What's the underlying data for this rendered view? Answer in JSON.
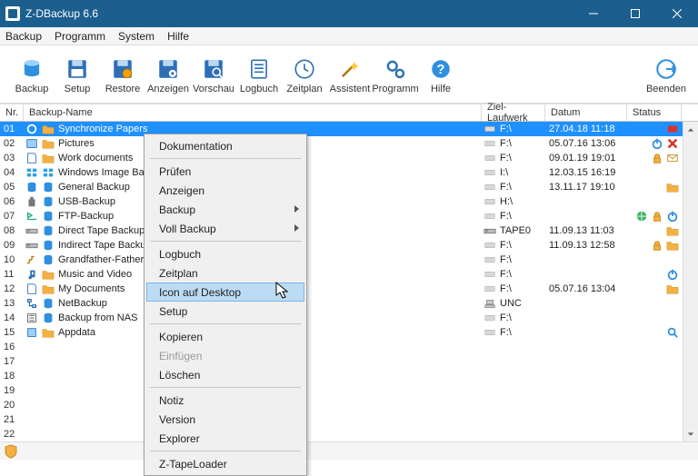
{
  "window": {
    "title": "Z-DBackup 6.6"
  },
  "menubar": [
    "Backup",
    "Programm",
    "System",
    "Hilfe"
  ],
  "toolbar": {
    "items": [
      {
        "label": "Backup",
        "icon": "cylinder"
      },
      {
        "label": "Setup",
        "icon": "floppy"
      },
      {
        "label": "Restore",
        "icon": "floppy-gear"
      },
      {
        "label": "Anzeigen",
        "icon": "floppy-eye"
      },
      {
        "label": "Vorschau",
        "icon": "floppy-search"
      },
      {
        "label": "Logbuch",
        "icon": "log"
      },
      {
        "label": "Zeitplan",
        "icon": "clock"
      },
      {
        "label": "Assistent",
        "icon": "wand"
      },
      {
        "label": "Programm",
        "icon": "gears"
      },
      {
        "label": "Hilfe",
        "icon": "question"
      }
    ],
    "end_label": "Beenden"
  },
  "columns": {
    "nr": "Nr.",
    "name": "Backup-Name",
    "drive": "Ziel-Laufwerk",
    "date": "Datum",
    "status": "Status"
  },
  "rows": [
    {
      "nr": "01",
      "ic1": "sync",
      "ic2": "folder",
      "name": "Synchronize Papers",
      "drvic": "drive",
      "drive": "F:\\",
      "date": "27.04.18 11:18",
      "status": [
        "badge-red"
      ],
      "selected": true
    },
    {
      "nr": "02",
      "ic1": "pic",
      "ic2": "folder",
      "name": "Pictures",
      "drvic": "drive",
      "drive": "F:\\",
      "date": "05.07.16 13:06",
      "status": [
        "power",
        "red-x"
      ]
    },
    {
      "nr": "03",
      "ic1": "doc",
      "ic2": "folder",
      "name": "Work documents",
      "drvic": "drive",
      "drive": "F:\\",
      "date": "09.01.19 19:01",
      "status": [
        "lock",
        "mail"
      ]
    },
    {
      "nr": "04",
      "ic1": "win",
      "ic2": "win",
      "name": "Windows Image Backup",
      "drvic": "drive",
      "drive": "I:\\",
      "date": "12.03.15 16:19",
      "status": []
    },
    {
      "nr": "05",
      "ic1": "gen",
      "ic2": "cyl",
      "name": "General Backup",
      "drvic": "drive",
      "drive": "F:\\",
      "date": "13.11.17 19:10",
      "status": [
        "folder"
      ]
    },
    {
      "nr": "06",
      "ic1": "usb",
      "ic2": "cyl",
      "name": "USB-Backup",
      "drvic": "drive",
      "drive": "H:\\",
      "date": "",
      "status": []
    },
    {
      "nr": "07",
      "ic1": "ftp",
      "ic2": "cyl",
      "name": "FTP-Backup",
      "drvic": "drive",
      "drive": "F:\\",
      "date": "",
      "status": [
        "globe",
        "lock",
        "power"
      ]
    },
    {
      "nr": "08",
      "ic1": "tape",
      "ic2": "cyl",
      "name": "Direct Tape Backup",
      "drvic": "tape",
      "drive": "TAPE0",
      "date": "11.09.13 11:03",
      "status": [
        "folder"
      ]
    },
    {
      "nr": "09",
      "ic1": "tape",
      "ic2": "cyl",
      "name": "Indirect Tape Backup",
      "drvic": "drive",
      "drive": "F:\\",
      "date": "11.09.13 12:58",
      "status": [
        "lock",
        "folder"
      ]
    },
    {
      "nr": "10",
      "ic1": "gfs",
      "ic2": "cyl",
      "name": "Grandfather-Father-Son",
      "drvic": "drive",
      "drive": "F:\\",
      "date": "",
      "status": []
    },
    {
      "nr": "11",
      "ic1": "mus",
      "ic2": "folder",
      "name": "Music and Video",
      "drvic": "drive",
      "drive": "F:\\",
      "date": "",
      "status": [
        "power"
      ]
    },
    {
      "nr": "12",
      "ic1": "doc",
      "ic2": "folder",
      "name": "My Documents",
      "drvic": "drive",
      "drive": "F:\\",
      "date": "05.07.16 13:04",
      "status": [
        "folder"
      ]
    },
    {
      "nr": "13",
      "ic1": "net",
      "ic2": "cyl",
      "name": "NetBackup",
      "drvic": "unc",
      "drive": "UNC",
      "date": "",
      "status": []
    },
    {
      "nr": "14",
      "ic1": "nas",
      "ic2": "cyl",
      "name": "Backup from NAS",
      "drvic": "drive",
      "drive": "F:\\",
      "date": "",
      "status": []
    },
    {
      "nr": "15",
      "ic1": "app",
      "ic2": "folder",
      "name": "Appdata",
      "drvic": "drive",
      "drive": "F:\\",
      "date": "",
      "status": [
        "search"
      ]
    },
    {
      "nr": "16"
    },
    {
      "nr": "17"
    },
    {
      "nr": "18"
    },
    {
      "nr": "19"
    },
    {
      "nr": "20"
    },
    {
      "nr": "21"
    },
    {
      "nr": "22"
    }
  ],
  "context_menu": {
    "groups": [
      [
        {
          "label": "Dokumentation"
        }
      ],
      [
        {
          "label": "Prüfen"
        },
        {
          "label": "Anzeigen"
        },
        {
          "label": "Backup",
          "submenu": true
        },
        {
          "label": "Voll Backup",
          "submenu": true
        }
      ],
      [
        {
          "label": "Logbuch"
        },
        {
          "label": "Zeitplan"
        },
        {
          "label": "Icon auf Desktop",
          "hover": true
        },
        {
          "label": "Setup"
        }
      ],
      [
        {
          "label": "Kopieren"
        },
        {
          "label": "Einfügen",
          "disabled": true
        },
        {
          "label": "Löschen"
        }
      ],
      [
        {
          "label": "Notiz"
        },
        {
          "label": "Version"
        },
        {
          "label": "Explorer"
        }
      ],
      [
        {
          "label": "Z-TapeLoader"
        }
      ]
    ]
  }
}
